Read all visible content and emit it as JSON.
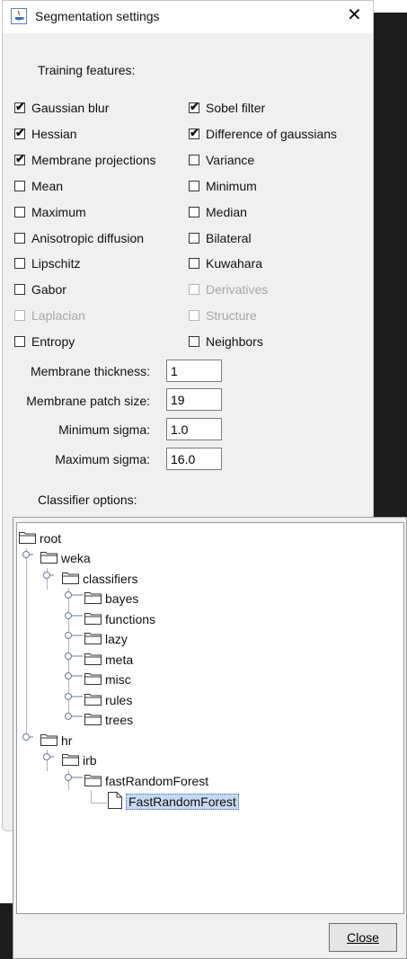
{
  "window": {
    "title": "Segmentation settings"
  },
  "training": {
    "label": "Training features:",
    "features": [
      {
        "label": "Gaussian blur",
        "checked": true,
        "enabled": true
      },
      {
        "label": "Sobel filter",
        "checked": true,
        "enabled": true
      },
      {
        "label": "Hessian",
        "checked": true,
        "enabled": true
      },
      {
        "label": "Difference of gaussians",
        "checked": true,
        "enabled": true
      },
      {
        "label": "Membrane projections",
        "checked": true,
        "enabled": true
      },
      {
        "label": "Variance",
        "checked": false,
        "enabled": true
      },
      {
        "label": "Mean",
        "checked": false,
        "enabled": true
      },
      {
        "label": "Minimum",
        "checked": false,
        "enabled": true
      },
      {
        "label": "Maximum",
        "checked": false,
        "enabled": true
      },
      {
        "label": "Median",
        "checked": false,
        "enabled": true
      },
      {
        "label": "Anisotropic diffusion",
        "checked": false,
        "enabled": true
      },
      {
        "label": "Bilateral",
        "checked": false,
        "enabled": true
      },
      {
        "label": "Lipschitz",
        "checked": false,
        "enabled": true
      },
      {
        "label": "Kuwahara",
        "checked": false,
        "enabled": true
      },
      {
        "label": "Gabor",
        "checked": false,
        "enabled": true
      },
      {
        "label": "Derivatives",
        "checked": false,
        "enabled": false
      },
      {
        "label": "Laplacian",
        "checked": false,
        "enabled": false
      },
      {
        "label": "Structure",
        "checked": false,
        "enabled": false
      },
      {
        "label": "Entropy",
        "checked": false,
        "enabled": true
      },
      {
        "label": "Neighbors",
        "checked": false,
        "enabled": true
      }
    ]
  },
  "params": {
    "membrane_thickness": {
      "label": "Membrane thickness:",
      "value": "1"
    },
    "membrane_patch_size": {
      "label": "Membrane patch size:",
      "value": "19"
    },
    "minimum_sigma": {
      "label": "Minimum sigma:",
      "value": "1.0"
    },
    "maximum_sigma": {
      "label": "Maximum sigma:",
      "value": "16.0"
    }
  },
  "classifier": {
    "label": "Classifier options:",
    "tree": [
      {
        "label": "root",
        "type": "folder"
      },
      {
        "label": "weka",
        "type": "folder"
      },
      {
        "label": "classifiers",
        "type": "folder"
      },
      {
        "label": "bayes",
        "type": "folder"
      },
      {
        "label": "functions",
        "type": "folder"
      },
      {
        "label": "lazy",
        "type": "folder"
      },
      {
        "label": "meta",
        "type": "folder"
      },
      {
        "label": "misc",
        "type": "folder"
      },
      {
        "label": "rules",
        "type": "folder"
      },
      {
        "label": "trees",
        "type": "folder"
      },
      {
        "label": "hr",
        "type": "folder"
      },
      {
        "label": "irb",
        "type": "folder"
      },
      {
        "label": "fastRandomForest",
        "type": "folder"
      },
      {
        "label": "FastRandomForest",
        "type": "leaf",
        "selected": true
      }
    ]
  },
  "buttons": {
    "close_label": "Close"
  },
  "colors": {
    "selection": "#c6d9f1",
    "dark_background": "#1c1c1c"
  }
}
